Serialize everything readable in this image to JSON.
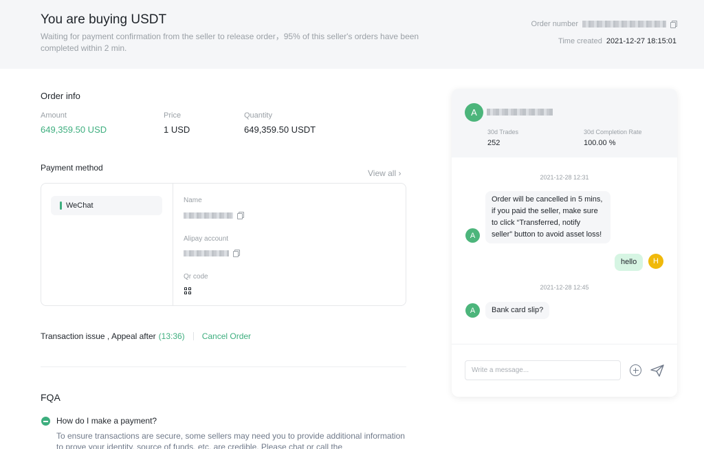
{
  "header": {
    "title": "You are buying USDT",
    "subtitle": "Waiting for payment confirmation from the seller to release order，95% of this seller's orders have been completed within 2 min.",
    "order_number_label": "Order number",
    "time_created_label": "Time created",
    "time_created_value": "2021-12-27 18:15:01"
  },
  "order_info": {
    "title": "Order info",
    "amount_label": "Amount",
    "amount_value": "649,359.50 USD",
    "price_label": "Price",
    "price_value": "1 USD",
    "quantity_label": "Quantity",
    "quantity_value": "649,359.50 USDT"
  },
  "payment_method": {
    "title": "Payment method",
    "view_all": "View all ›",
    "selected_method": "WeChat",
    "name_label": "Name",
    "account_label": "Alipay account",
    "qr_label": "Qr code"
  },
  "transaction": {
    "issue_text": "Transaction issue , Appeal after ",
    "countdown": "(13:36)",
    "cancel_label": "Cancel Order"
  },
  "fqa": {
    "title": "FQA",
    "question": "How do I make a payment?",
    "answer": "To ensure transactions are secure, some sellers may need you to provide additional information to prove your identity, source of funds, etc. are credible. Please chat or call the"
  },
  "chat": {
    "seller_initial": "A",
    "trades_label": "30d Trades",
    "trades_value": "252",
    "completion_label": "30d Completion Rate",
    "completion_value": "100.00 %",
    "ts1": "2021-12-28 12:31",
    "msg1_line1": "Order will be cancelled in 5 mins,",
    "msg1_line2": "if you paid the seller, make sure",
    "msg1_line3": "to click “Transferred, notify",
    "msg1_line4": "seller” button to avoid asset loss!",
    "msg2": "hello",
    "me_initial": "H",
    "ts2": "2021-12-28 12:45",
    "msg3": "Bank card slip?",
    "input_placeholder": "Write a message..."
  },
  "colors": {
    "accent_green": "#3dae7e",
    "avatar_green": "#4cb57b",
    "avatar_yellow": "#f0b90b",
    "header_bg": "#f5f6f8"
  },
  "icons": [
    "copy-icon",
    "chevron-right-icon",
    "qr-code-icon",
    "minus-circle-icon",
    "plus-circle-icon",
    "send-icon"
  ]
}
